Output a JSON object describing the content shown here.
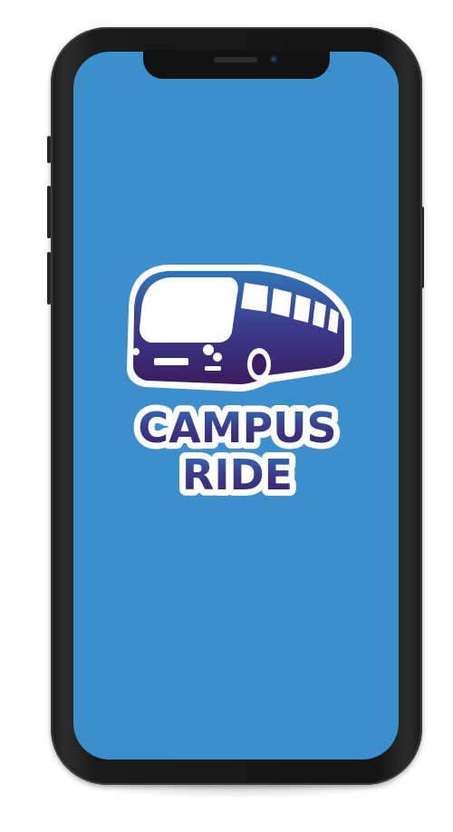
{
  "app": {
    "logo_line1": "CAMPUS",
    "logo_line2": "RIDE"
  },
  "colors": {
    "screen_background": "#3b8fcc",
    "bus_top": "#2b6fb0",
    "bus_bottom": "#3a1e63",
    "logo_outline": "#ffffff",
    "phone_body": "#1a1a1a"
  },
  "icons": {
    "logo": "bus-icon"
  }
}
